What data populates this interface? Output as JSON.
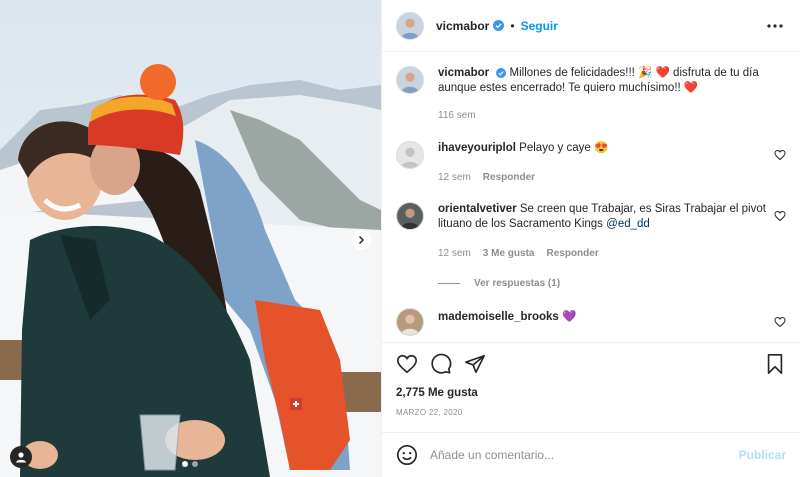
{
  "post": {
    "username": "vicmabor",
    "follow_label": "Seguir",
    "separator": "•",
    "likes": "2,775 Me gusta",
    "date": "MARZO 22, 2020"
  },
  "caption": {
    "username": "vicmabor",
    "text_line1": "Millones de felicidades!!! 🎉 ❤️ disfruta de tu día",
    "text_line2": "aunque estes encerrado! Te quiero muchísimo!! ❤️",
    "time": "116 sem"
  },
  "comments": [
    {
      "username": "ihaveyouriplol",
      "text": "Pelayo y caye 😍",
      "time": "12 sem",
      "reply_label": "Responder"
    },
    {
      "username": "orientalvetiver",
      "text": "Se creen que Trabajar, es Siras Trabajar el pivot lituano de los Sacramento Kings",
      "mention": "@ed_dd",
      "time": "12 sem",
      "likes": "3 Me gusta",
      "reply_label": "Responder",
      "view_replies": "Ver respuestas (1)"
    },
    {
      "username": "mademoiselle_brooks",
      "text": "💜"
    }
  ],
  "add_comment": {
    "placeholder": "Añade un comentario...",
    "publish_label": "Publicar"
  },
  "icons": {
    "more": "more-options-icon",
    "like": "heart-icon",
    "comment": "comment-icon",
    "share": "share-icon",
    "save": "bookmark-icon",
    "emoji": "emoji-icon",
    "next": "chevron-right-icon",
    "tags": "user-tag-icon",
    "verified": "verified-badge-icon"
  },
  "colors": {
    "accent": "#0095f6",
    "verified": "#3897f0",
    "publish_disabled": "#b3dbff",
    "muted": "#8e8e8e"
  },
  "carousel": {
    "count": 2,
    "active_index": 0
  }
}
